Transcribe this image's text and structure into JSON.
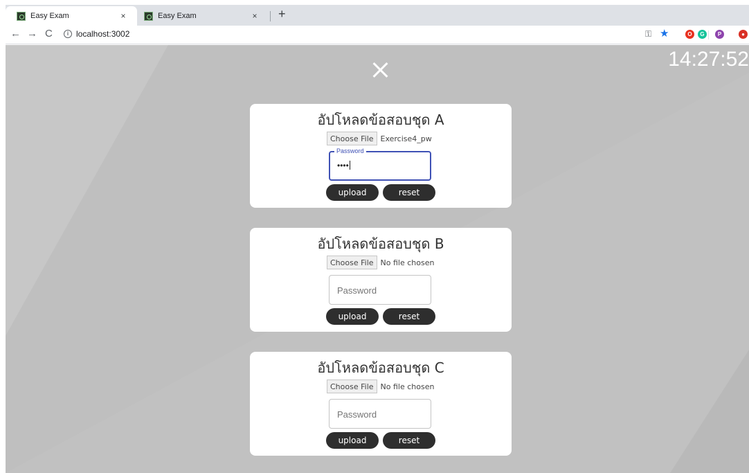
{
  "browser": {
    "tabs": [
      {
        "title": "Easy Exam",
        "close": "×",
        "active": true
      },
      {
        "title": "Easy Exam",
        "close": "×",
        "active": false
      }
    ],
    "new_tab": "+",
    "nav": {
      "back": "←",
      "forward": "→",
      "reload": "C"
    },
    "url": "localhost:3002",
    "toolbar_icons": [
      "key-icon",
      "star-icon",
      "opera-extension-icon",
      "grammarly-extension-icon",
      "profile-p-icon",
      "red-extension-icon"
    ],
    "profile_letter": "P"
  },
  "page": {
    "clock": "14:27:52",
    "close_icon": "close-icon",
    "background_color": "#c1c1c1",
    "cards": [
      {
        "title": "อัปโหลดข้อสอบชุด A",
        "choose_file_label": "Choose File",
        "file_status": "Exercise4_pw",
        "password_label": "Password",
        "password_value": "••••",
        "password_focused": true,
        "upload_label": "upload",
        "reset_label": "reset"
      },
      {
        "title": "อัปโหลดข้อสอบชุด B",
        "choose_file_label": "Choose File",
        "file_status": "No file chosen",
        "password_placeholder": "Password",
        "upload_label": "upload",
        "reset_label": "reset"
      },
      {
        "title": "อัปโหลดข้อสอบชุด C",
        "choose_file_label": "Choose File",
        "file_status": "No file chosen",
        "password_placeholder": "Password",
        "upload_label": "upload",
        "reset_label": "reset"
      }
    ]
  }
}
